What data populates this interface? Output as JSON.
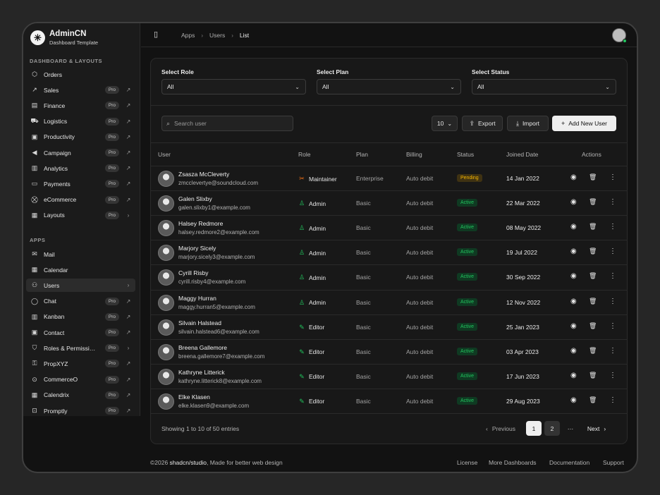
{
  "brand": {
    "name": "AdminCN",
    "subtitle": "Dashboard Template",
    "logo": "✳"
  },
  "sidebar": {
    "section1": "DASHBOARD & LAYOUTS",
    "section2": "APPS",
    "items1": [
      {
        "label": "Orders",
        "icon": "box-icon",
        "glyph": "⬡",
        "pro": "",
        "end": ""
      },
      {
        "label": "Sales",
        "icon": "trending-up-icon",
        "glyph": "↗",
        "pro": "Pro",
        "end": "↗"
      },
      {
        "label": "Finance",
        "icon": "wallet-icon",
        "glyph": "▤",
        "pro": "Pro",
        "end": "↗"
      },
      {
        "label": "Logistics",
        "icon": "truck-icon",
        "glyph": "⛟",
        "pro": "Pro",
        "end": "↗"
      },
      {
        "label": "Productivity",
        "icon": "briefcase-icon",
        "glyph": "▣",
        "pro": "Pro",
        "end": "↗"
      },
      {
        "label": "Campaign",
        "icon": "megaphone-icon",
        "glyph": "◀",
        "pro": "Pro",
        "end": "↗"
      },
      {
        "label": "Analytics",
        "icon": "chart-icon",
        "glyph": "▥",
        "pro": "Pro",
        "end": "↗"
      },
      {
        "label": "Payments",
        "icon": "credit-card-icon",
        "glyph": "▭",
        "pro": "Pro",
        "end": "↗"
      },
      {
        "label": "eCommerce",
        "icon": "cart-icon",
        "glyph": "⛒",
        "pro": "Pro",
        "end": "↗"
      },
      {
        "label": "Layouts",
        "icon": "layout-icon",
        "glyph": "▦",
        "pro": "Pro",
        "end": "›"
      }
    ],
    "items2": [
      {
        "label": "Mail",
        "icon": "mail-icon",
        "glyph": "✉",
        "pro": "",
        "end": ""
      },
      {
        "label": "Calendar",
        "icon": "calendar-icon",
        "glyph": "▦",
        "pro": "",
        "end": ""
      },
      {
        "label": "Users",
        "icon": "users-icon",
        "glyph": "⚇",
        "pro": "",
        "end": "›"
      },
      {
        "label": "Chat",
        "icon": "chat-icon",
        "glyph": "◯",
        "pro": "Pro",
        "end": "↗"
      },
      {
        "label": "Kanban",
        "icon": "kanban-icon",
        "glyph": "▥",
        "pro": "Pro",
        "end": "↗"
      },
      {
        "label": "Contact",
        "icon": "contact-icon",
        "glyph": "▣",
        "pro": "Pro",
        "end": "↗"
      },
      {
        "label": "Roles & Permissi…",
        "icon": "shield-icon",
        "glyph": "⛉",
        "pro": "Pro",
        "end": "›"
      },
      {
        "label": "PropXYZ",
        "icon": "key-icon",
        "glyph": "⚿",
        "pro": "Pro",
        "end": "↗"
      },
      {
        "label": "CommerceO",
        "icon": "shop-icon",
        "glyph": "⊙",
        "pro": "Pro",
        "end": "↗"
      },
      {
        "label": "Calendrix",
        "icon": "calendar-check-icon",
        "glyph": "▦",
        "pro": "Pro",
        "end": "↗"
      },
      {
        "label": "Promptly",
        "icon": "bot-icon",
        "glyph": "⊡",
        "pro": "Pro",
        "end": "↗"
      }
    ]
  },
  "topbar": {
    "crumbs": [
      "Apps",
      "Users",
      "List"
    ],
    "sep": "›"
  },
  "filters": [
    {
      "label": "Select Role",
      "value": "All"
    },
    {
      "label": "Select Plan",
      "value": "All"
    },
    {
      "label": "Select Status",
      "value": "All"
    }
  ],
  "toolbar": {
    "search_placeholder": "Search user",
    "page_size": "10",
    "export": "Export",
    "import": "Import",
    "add": "Add New User"
  },
  "table": {
    "headers": [
      "User",
      "Role",
      "Plan",
      "Billing",
      "Status",
      "Joined Date",
      "Actions"
    ],
    "rows": [
      {
        "name": "Zsasza McCleverty",
        "email": "zmcclevertye@soundcloud.com",
        "role": "Maintainer",
        "role_glyph": "✂",
        "role_color": "#f97316",
        "plan": "Enterprise",
        "billing": "Auto debit",
        "status": "Pending",
        "joined": "14 Jan 2022"
      },
      {
        "name": "Galen Slixby",
        "email": "galen.slixby1@example.com",
        "role": "Admin",
        "role_glyph": "♙",
        "role_color": "#22c55e",
        "plan": "Basic",
        "billing": "Auto debit",
        "status": "Active",
        "joined": "22 Mar 2022"
      },
      {
        "name": "Halsey Redmore",
        "email": "halsey.redmore2@example.com",
        "role": "Admin",
        "role_glyph": "♙",
        "role_color": "#22c55e",
        "plan": "Basic",
        "billing": "Auto debit",
        "status": "Active",
        "joined": "08 May 2022"
      },
      {
        "name": "Marjory Sicely",
        "email": "marjory.sicely3@example.com",
        "role": "Admin",
        "role_glyph": "♙",
        "role_color": "#22c55e",
        "plan": "Basic",
        "billing": "Auto debit",
        "status": "Active",
        "joined": "19 Jul 2022"
      },
      {
        "name": "Cyrill Risby",
        "email": "cyrill.risby4@example.com",
        "role": "Admin",
        "role_glyph": "♙",
        "role_color": "#22c55e",
        "plan": "Basic",
        "billing": "Auto debit",
        "status": "Active",
        "joined": "30 Sep 2022"
      },
      {
        "name": "Maggy Hurran",
        "email": "maggy.hurran5@example.com",
        "role": "Admin",
        "role_glyph": "♙",
        "role_color": "#22c55e",
        "plan": "Basic",
        "billing": "Auto debit",
        "status": "Active",
        "joined": "12 Nov 2022"
      },
      {
        "name": "Silvain Halstead",
        "email": "silvain.halstead6@example.com",
        "role": "Editor",
        "role_glyph": "✎",
        "role_color": "#22c55e",
        "plan": "Basic",
        "billing": "Auto debit",
        "status": "Active",
        "joined": "25 Jan 2023"
      },
      {
        "name": "Breena Gallemore",
        "email": "breena.gallemore7@example.com",
        "role": "Editor",
        "role_glyph": "✎",
        "role_color": "#22c55e",
        "plan": "Basic",
        "billing": "Auto debit",
        "status": "Active",
        "joined": "03 Apr 2023"
      },
      {
        "name": "Kathryne Litterick",
        "email": "kathryne.litterick8@example.com",
        "role": "Editor",
        "role_glyph": "✎",
        "role_color": "#22c55e",
        "plan": "Basic",
        "billing": "Auto debit",
        "status": "Active",
        "joined": "17 Jun 2023"
      },
      {
        "name": "Elke Klasen",
        "email": "elke.klasen9@example.com",
        "role": "Editor",
        "role_glyph": "✎",
        "role_color": "#22c55e",
        "plan": "Basic",
        "billing": "Auto debit",
        "status": "Active",
        "joined": "29 Aug 2023"
      }
    ]
  },
  "pagination": {
    "summary": "Showing 1 to 10 of 50 entries",
    "previous": "Previous",
    "pages": [
      "1",
      "2"
    ],
    "current": "1",
    "ellipsis": "···",
    "next": "Next"
  },
  "footer": {
    "copyright": "©2026 ",
    "brand": "shadcn/studio",
    "tagline": ", Made for better web design",
    "links": [
      "License",
      "More Dashboards",
      "Documentation",
      "Support"
    ]
  }
}
